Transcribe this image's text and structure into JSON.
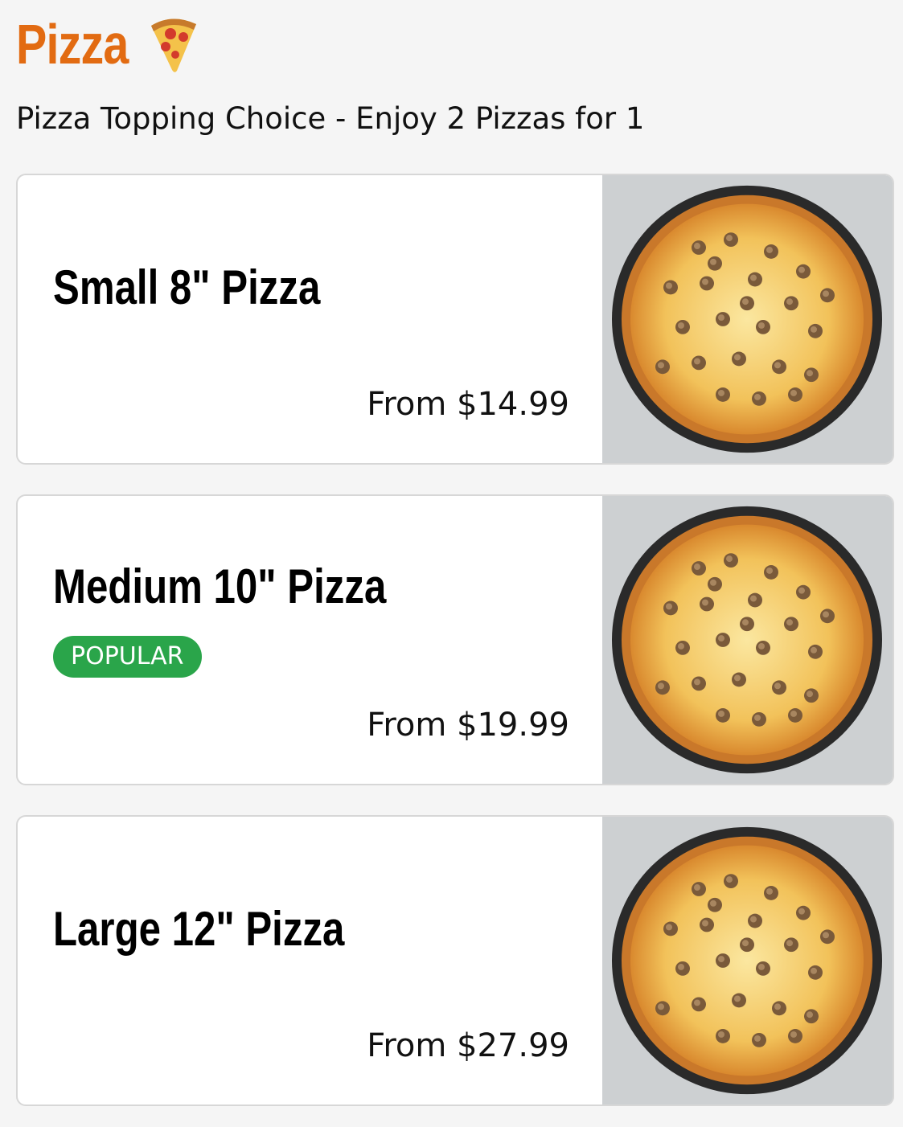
{
  "category": {
    "title": "Pizza",
    "icon": "pizza-slice-icon",
    "subtitle": "Pizza Topping Choice - Enjoy 2 Pizzas for 1"
  },
  "items": [
    {
      "name": "Small 8\" Pizza",
      "price": "From $14.99",
      "image": "pizza-photo"
    },
    {
      "name": "Medium 10\" Pizza",
      "badge": "POPULAR",
      "price": "From $19.99",
      "image": "pizza-photo"
    },
    {
      "name": "Large 12\" Pizza",
      "price": "From $27.99",
      "image": "pizza-photo"
    }
  ],
  "colors": {
    "accent": "#e26b12",
    "badge": "#2aa54a",
    "background": "#f5f5f5",
    "card": "#ffffff"
  }
}
